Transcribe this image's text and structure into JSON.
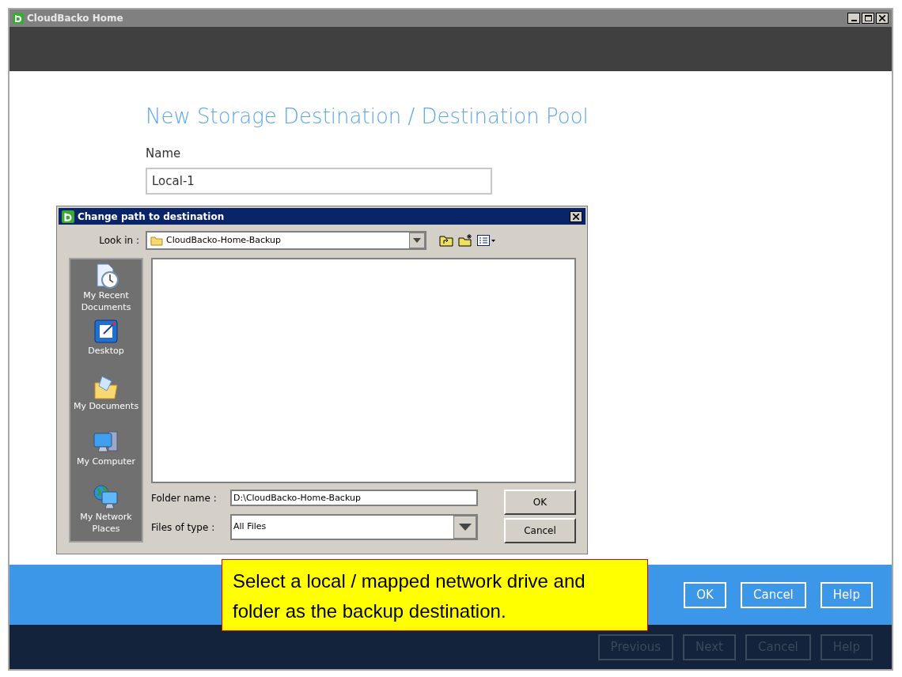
{
  "window": {
    "title": "CloudBacko Home"
  },
  "page": {
    "heading": "New Storage Destination / Destination Pool",
    "name_label": "Name",
    "name_value": "Local-1"
  },
  "dialog": {
    "title": "Change path to destination",
    "look_in_label": "Look in :",
    "look_in_value": "CloudBacko-Home-Backup",
    "places": [
      {
        "kind": "recent",
        "label": "My Recent Documents"
      },
      {
        "kind": "desktop",
        "label": "Desktop"
      },
      {
        "kind": "documents",
        "label": "My Documents"
      },
      {
        "kind": "computer",
        "label": "My Computer"
      },
      {
        "kind": "network",
        "label": "My Network Places"
      }
    ],
    "folder_name_label": "Folder name :",
    "folder_name_value": "D:\\CloudBacko-Home-Backup",
    "file_type_label": "Files of type :",
    "file_type_value": "All Files",
    "buttons": [
      "OK",
      "Cancel"
    ]
  },
  "action_buttons": [
    {
      "label": "OK",
      "disabled": false
    },
    {
      "label": "Cancel",
      "disabled": false
    },
    {
      "label": "Help",
      "disabled": false
    }
  ],
  "nav_buttons": [
    {
      "label": "Previous",
      "disabled": true
    },
    {
      "label": "Next",
      "disabled": true
    },
    {
      "label": "Cancel",
      "disabled": true
    },
    {
      "label": "Help",
      "disabled": true
    }
  ],
  "callout": {
    "text": "Select a local / mapped network drive and folder as the backup destination."
  }
}
